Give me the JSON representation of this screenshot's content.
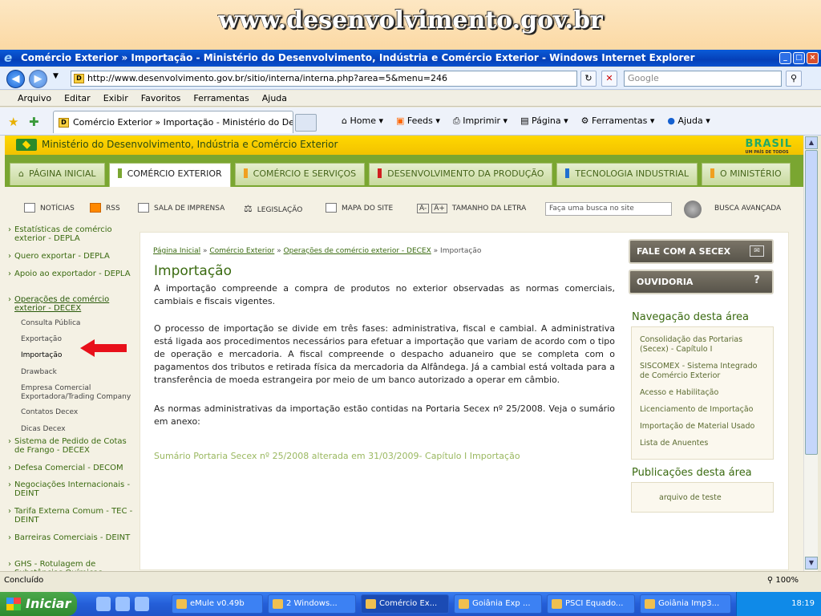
{
  "banner": {
    "title": "www.desenvolvimento.gov.br"
  },
  "window": {
    "title": "Comércio Exterior » Importação - Ministério do Desenvolvimento, Indústria e Comércio Exterior - Windows Internet Explorer",
    "url": "http://www.desenvolvimento.gov.br/sitio/interna/interna.php?area=5&menu=246",
    "search_placeholder": "Google",
    "tab_title": "Comércio Exterior » Importação - Ministério do Desen...",
    "menu": [
      "Arquivo",
      "Editar",
      "Exibir",
      "Favoritos",
      "Ferramentas",
      "Ajuda"
    ],
    "commands": [
      "Home",
      "Feeds",
      "Imprimir",
      "Página",
      "Ferramentas",
      "Ajuda"
    ],
    "status": "Concluído",
    "zoom": "100%"
  },
  "site": {
    "ministry": "Ministério do Desenvolvimento, Indústria e Comércio Exterior",
    "brand": "BRASIL",
    "brand_sub": "UM PAÍS DE TODOS",
    "nav": [
      {
        "label": "PÁGINA INICIAL",
        "color": "#7aa631"
      },
      {
        "label": "COMÉRCIO EXTERIOR",
        "color": "#7aa631"
      },
      {
        "label": "COMÉRCIO E SERVIÇOS",
        "color": "#f0a020"
      },
      {
        "label": "DESENVOLVIMENTO DA PRODUÇÃO",
        "color": "#d02020"
      },
      {
        "label": "TECNOLOGIA INDUSTRIAL",
        "color": "#2070d0"
      },
      {
        "label": "O MINISTÉRIO",
        "color": "#f0a020"
      }
    ],
    "util": [
      "NOTÍCIAS",
      "RSS",
      "SALA DE IMPRENSA",
      "LEGISLAÇÃO",
      "MAPA DO SITE",
      "TAMANHO DA LETRA"
    ],
    "font_small": "A-",
    "font_large": "A+",
    "site_search_placeholder": "Faça uma busca no site",
    "advanced_search": "BUSCA AVANÇADA"
  },
  "sidebar": {
    "items": [
      "Estatísticas de comércio exterior - DEPLA",
      "Quero exportar - DEPLA",
      "Apoio ao exportador - DEPLA",
      "Operações de comércio exterior - DECEX",
      "Sistema de Pedido de Cotas de Frango - DECEX",
      "Defesa Comercial - DECOM",
      "Negociações Internacionais - DEINT",
      "Tarifa Externa Comum - TEC - DEINT",
      "Barreiras Comerciais - DEINT",
      "GHS - Rotulagem de Substâncias Químicas"
    ],
    "subitems": [
      "Consulta Pública",
      "Exportação",
      "Importação",
      "Drawback",
      "Empresa Comercial Exportadora/Trading Company",
      "Contatos Decex",
      "Dicas Decex"
    ]
  },
  "content": {
    "breadcrumb": [
      "Página Inicial",
      "Comércio Exterior",
      "Operações de comércio exterior - DECEX",
      "Importação"
    ],
    "breadcrumb_sep": "»",
    "title": "Importação",
    "p1": "A importação compreende a compra de produtos no exterior observadas as normas comerciais, cambiais e fiscais vigentes.",
    "p2": "O processo de importação se divide em três fases: administrativa, fiscal e cambial. A administrativa está ligada aos procedimentos necessários para efetuar a importação que variam de acordo com o tipo de operação e mercadoria. A fiscal compreende o despacho aduaneiro que se completa com o pagamentos dos tributos e retirada física da mercadoria da Alfândega. Já a cambial está voltada para a transferência de moeda estrangeira por meio de um banco autorizado a operar em câmbio.",
    "p3": "As normas administrativas da importação estão contidas na Portaria Secex nº 25/2008. Veja o sumário em anexo:",
    "link": "Sumário Portaria Secex nº 25/2008 alterada em 31/03/2009- Capítulo I Importação"
  },
  "right": {
    "btn1": "FALE COM A SECEX",
    "btn2": "OUVIDORIA",
    "nav_title": "Navegação desta área",
    "nav_links": [
      "Consolidação das Portarias (Secex) - Capítulo I",
      "SISCOMEX - Sistema Integrado de Comércio Exterior",
      "Acesso e Habilitação",
      "Licenciamento de Importação",
      "Importação de Material Usado",
      "Lista de Anuentes"
    ],
    "pub_title": "Publicações desta área",
    "pub_links": [
      "arquivo de teste"
    ]
  },
  "taskbar": {
    "start": "Iniciar",
    "items": [
      "eMule v0.49b",
      "2 Windows...",
      "Comércio Ex...",
      "Goiânia  Exp ...",
      "PSCI Equado...",
      "Goiânia Imp3..."
    ],
    "clock": "18:19"
  }
}
